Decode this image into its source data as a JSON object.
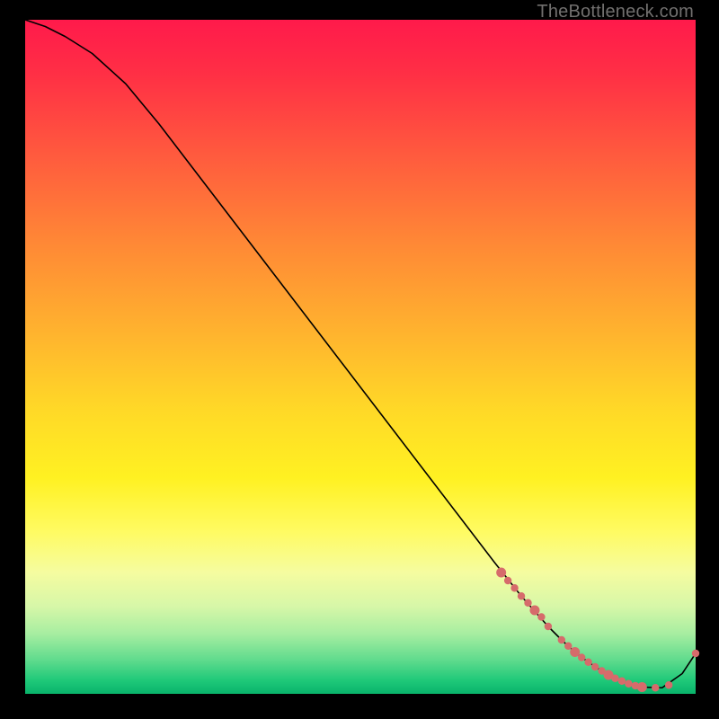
{
  "watermark": "TheBottleneck.com",
  "chart_data": {
    "type": "line",
    "title": "",
    "xlabel": "",
    "ylabel": "",
    "xlim": [
      0,
      100
    ],
    "ylim": [
      0,
      100
    ],
    "series": [
      {
        "name": "bottleneck-curve",
        "x": [
          0,
          3,
          6,
          10,
          15,
          20,
          25,
          30,
          35,
          40,
          45,
          50,
          55,
          60,
          65,
          70,
          74,
          78,
          80,
          82,
          84,
          86,
          88,
          90,
          92,
          95,
          98,
          100
        ],
        "y": [
          100,
          99,
          97.5,
          95,
          90.5,
          84.5,
          78,
          71.5,
          65,
          58.5,
          52,
          45.5,
          39,
          32.5,
          26,
          19.5,
          14.5,
          10,
          8,
          6.2,
          4.7,
          3.4,
          2.3,
          1.5,
          1.0,
          0.9,
          3.0,
          6.0
        ]
      }
    ],
    "highlight_points": {
      "name": "highlighted-range",
      "x": [
        71,
        72,
        73,
        74,
        75,
        76,
        77,
        78,
        80,
        81,
        82,
        83,
        84,
        85,
        86,
        87,
        88,
        89,
        90,
        91,
        92,
        94,
        96,
        100
      ],
      "y": [
        18,
        16.8,
        15.7,
        14.5,
        13.5,
        12.4,
        11.4,
        10,
        8,
        7.1,
        6.2,
        5.4,
        4.7,
        4.0,
        3.4,
        2.8,
        2.3,
        1.9,
        1.5,
        1.2,
        1.0,
        0.9,
        1.3,
        6.0
      ]
    },
    "colors": {
      "line": "#000000",
      "points": "#d66b6b"
    }
  }
}
